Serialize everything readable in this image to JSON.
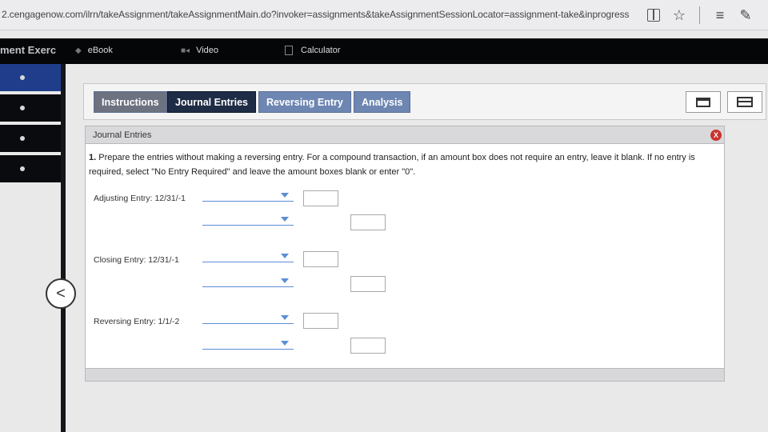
{
  "browser": {
    "url": "2.cengagenow.com/ilrn/takeAssignment/takeAssignmentMain.do?invoker=assignments&takeAssignmentSessionLocator=assignment-take&inprogress",
    "icons": [
      "reading-view-icon",
      "favorite-star-icon",
      "hub-icon",
      "web-note-icon"
    ]
  },
  "app": {
    "title": "ment Exerc",
    "tools": [
      {
        "label": "eBook",
        "icon": "ebook-icon"
      },
      {
        "label": "Video",
        "icon": "video-icon"
      },
      {
        "label": "Calculator",
        "icon": "calculator-icon"
      }
    ],
    "back_label": "<"
  },
  "tabs": [
    {
      "label": "Instructions",
      "state": "inactive"
    },
    {
      "label": "Journal Entries",
      "state": "active"
    },
    {
      "label": "Reversing Entry",
      "state": "inactive"
    },
    {
      "label": "Analysis",
      "state": "inactive"
    }
  ],
  "panel": {
    "title": "Journal Entries",
    "close_label": "X",
    "instruction_number": "1.",
    "instruction_text": "Prepare the entries without making a reversing entry. For a compound transaction, if an amount box does not require an entry, leave it blank. If no entry is required, select \"No Entry Required\" and leave the amount boxes blank or enter \"0\".",
    "entries": [
      {
        "label": "Adjusting Entry: 12/31/-1"
      },
      {
        "label": "Closing Entry: 12/31/-1"
      },
      {
        "label": "Reversing Entry: 1/1/-2"
      }
    ]
  },
  "colors": {
    "active_tab": "#1f2c46",
    "inactive_tab": "#6e86b2",
    "dropdown_accent": "#5b8fd6",
    "close": "#c9342f",
    "active_nav": "#1f3d8a"
  }
}
